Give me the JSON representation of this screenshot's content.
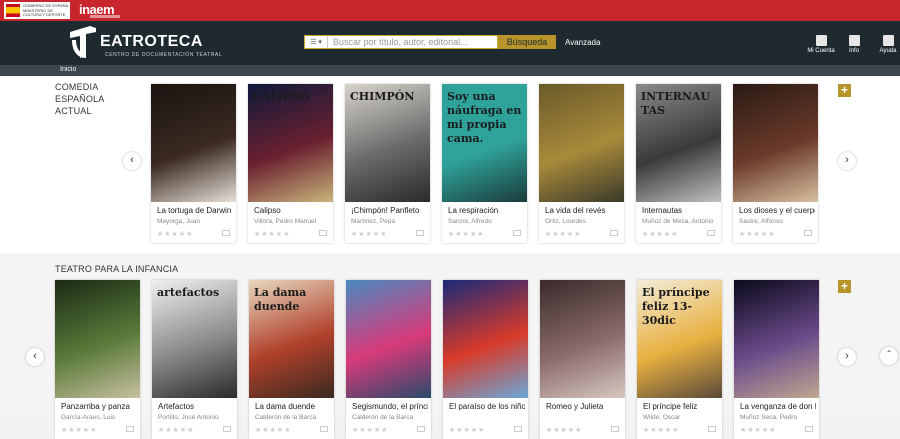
{
  "topbar": {
    "gov_text": "GOBIERNO DE ESPAÑA MINISTERIO DE CULTURA Y DEPORTE",
    "brand": "inaem"
  },
  "header": {
    "brand_name": "EATROTECA",
    "brand_sub": "CENTRO DE DOCUMENTACIÓN TEATRAL",
    "search_type_icon": "list-icon",
    "search_placeholder": "Buscar por título, autor, editorial...",
    "search_button": "Búsqueda",
    "advanced_link": "Avanzada",
    "actions": [
      {
        "label": "Mi Cuenta",
        "icon": "user-icon"
      },
      {
        "label": "Info",
        "icon": "info-icon"
      },
      {
        "label": "Ayuda",
        "icon": "help-icon"
      }
    ]
  },
  "nav": {
    "breadcrumb": "Inicio"
  },
  "sections": [
    {
      "title": "COMEDIA ESPAÑOLA ACTUAL",
      "add_label": "+",
      "items": [
        {
          "title": "La tortuga de Darwin",
          "author": "Mayorga, Juan",
          "cover_text": "",
          "colors": [
            "#1a1410",
            "#3a2a20",
            "#e8e0d8"
          ]
        },
        {
          "title": "Calipso",
          "author": "Villora, Pedro Manuel",
          "cover_text": "CALIPSO",
          "colors": [
            "#0e1a3a",
            "#6a2030",
            "#c9b57a"
          ]
        },
        {
          "title": "¡Chimpón! Panfleto",
          "author": "Martínez, Pepa",
          "cover_text": "CHIMPÓN",
          "colors": [
            "#d8d4cc",
            "#6a6a6a",
            "#2a2a2a"
          ]
        },
        {
          "title": "La respiración",
          "author": "Sanzol, Alfredo",
          "cover_text": "Soy una náufraga en mi propia cama.",
          "colors": [
            "#2fa39a",
            "#2fa39a",
            "#1b3a3a"
          ]
        },
        {
          "title": "La vida del revés",
          "author": "Ortiz, Lourdes",
          "cover_text": "",
          "colors": [
            "#6a5a2a",
            "#a88a3a",
            "#3a3a2a"
          ]
        },
        {
          "title": "Internautas",
          "author": "Muñoz de Mesa, Antonio",
          "cover_text": "INTERNAUTAS",
          "colors": [
            "#8a8a8a",
            "#3a3a3a",
            "#c0c0c0"
          ]
        },
        {
          "title": "Los dioses y el cuerpo",
          "author": "Sastre, Alfonso",
          "cover_text": "",
          "colors": [
            "#2a1a14",
            "#6a3a2a",
            "#d8c0a0"
          ]
        }
      ]
    },
    {
      "title": "TEATRO PARA LA INFANCIA",
      "add_label": "+",
      "items": [
        {
          "title": "Panzarriba y panza",
          "author": "García-Araus, Luis",
          "cover_text": "",
          "colors": [
            "#1a2a14",
            "#5a7a3a",
            "#c8c0a0"
          ]
        },
        {
          "title": "Artefactos",
          "author": "Portillo, José Antonio",
          "cover_text": "artefactos",
          "colors": [
            "#f0f0f0",
            "#8a8a8a",
            "#2a2a2a"
          ]
        },
        {
          "title": "La dama duende",
          "author": "Calderón de la Barca",
          "cover_text": "La dama duende",
          "colors": [
            "#e8d8c0",
            "#b0402a",
            "#3a2a20"
          ]
        },
        {
          "title": "Segismundo, el príncipe",
          "author": "Calderón de la Barca",
          "cover_text": "",
          "colors": [
            "#4a8ac0",
            "#d83a7a",
            "#2a4a6a"
          ]
        },
        {
          "title": "El paraíso de los niños",
          "author": "",
          "cover_text": "",
          "colors": [
            "#1a2a7a",
            "#d83a2a",
            "#6aa8d8"
          ]
        },
        {
          "title": "Romeo y Julieta",
          "author": "",
          "cover_text": "",
          "colors": [
            "#3a2a2a",
            "#8a6a6a",
            "#d8c8c0"
          ]
        },
        {
          "title": "El príncipe feliz",
          "author": "Wilde, Oscar",
          "cover_text": "El príncipe feliz 13-30dic",
          "colors": [
            "#f2ecd8",
            "#e8b040",
            "#5a4a3a"
          ]
        },
        {
          "title": "La venganza de don Mendo",
          "author": "Muñoz Seca, Pedro",
          "cover_text": "",
          "colors": [
            "#0a0a1a",
            "#6a4a8a",
            "#c0a890"
          ]
        }
      ]
    }
  ],
  "carousel": {
    "prev": "‹",
    "next": "›"
  },
  "rating_placeholder": "★★★★★",
  "scroll_top": "ˆ"
}
